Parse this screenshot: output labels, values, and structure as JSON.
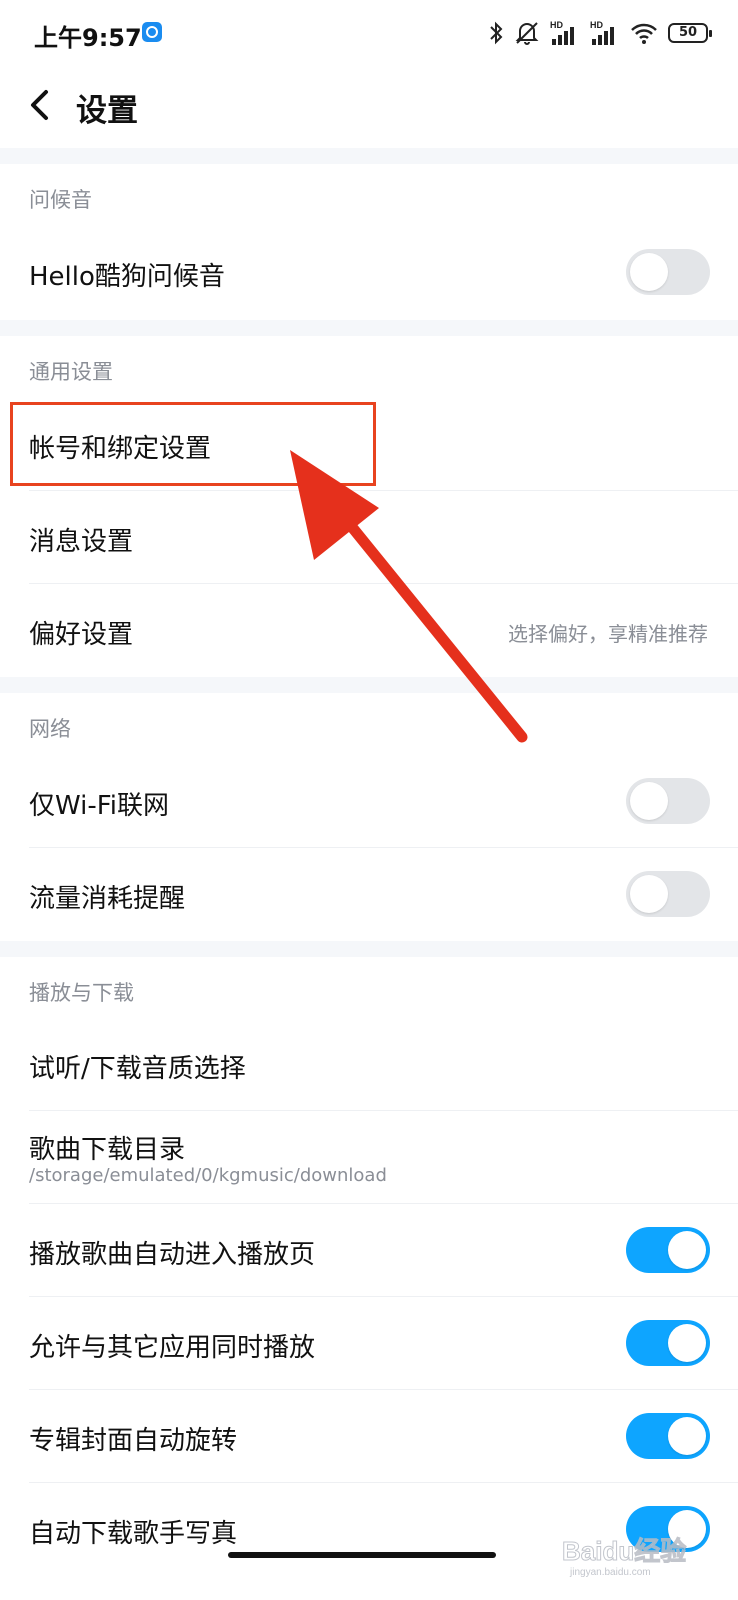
{
  "status_bar": {
    "time": "上午9:57",
    "app_icon": "kugou-app-icon",
    "icons": [
      "bluetooth-icon",
      "mute-bell-icon",
      "hd-signal-icon",
      "hd-signal-icon",
      "wifi-icon",
      "battery-icon"
    ],
    "hd_label": "HD",
    "battery": "50"
  },
  "header": {
    "back_icon": "chevron-left-icon",
    "title": "设置"
  },
  "sections": [
    {
      "label": "问候音",
      "rows": [
        {
          "label": "Hello酷狗问候音",
          "control": "toggle",
          "on": false
        }
      ]
    },
    {
      "label": "通用设置",
      "rows": [
        {
          "label": "帐号和绑定设置",
          "control": "none"
        },
        {
          "label": "消息设置",
          "control": "none"
        },
        {
          "label": "偏好设置",
          "control": "hint",
          "hint": "选择偏好，享精准推荐"
        }
      ]
    },
    {
      "label": "网络",
      "rows": [
        {
          "label": "仅Wi-Fi联网",
          "control": "toggle",
          "on": false
        },
        {
          "label": "流量消耗提醒",
          "control": "toggle",
          "on": false
        }
      ]
    },
    {
      "label": "播放与下载",
      "rows": [
        {
          "label": "试听/下载音质选择",
          "control": "none"
        },
        {
          "label": "歌曲下载目录",
          "sub": "/storage/emulated/0/kgmusic/download",
          "control": "none"
        },
        {
          "label": "播放歌曲自动进入播放页",
          "control": "toggle",
          "on": true
        },
        {
          "label": "允许与其它应用同时播放",
          "control": "toggle",
          "on": true
        },
        {
          "label": "专辑封面自动旋转",
          "control": "toggle",
          "on": true
        },
        {
          "label": "自动下载歌手写真",
          "control": "toggle",
          "on": true
        }
      ]
    }
  ],
  "annotation": {
    "box_color": "#e8431f",
    "arrow_color": "#e5301c"
  },
  "watermark": {
    "text": "Baidu经验",
    "subtext": "jingyan.baidu.com"
  },
  "colors": {
    "toggle_on": "#0ea5ff",
    "toggle_off": "#e3e5e8",
    "section_label": "#8a8e96",
    "band": "#f5f7fa"
  }
}
